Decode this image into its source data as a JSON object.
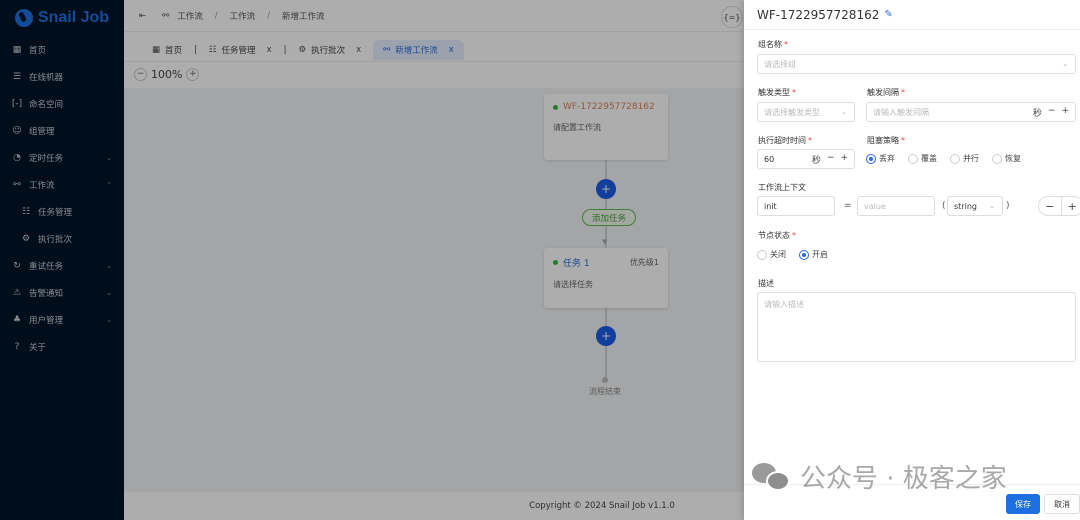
{
  "sidebar": {
    "logo": "Snail Job",
    "items": [
      {
        "icon": "dashboard-icon",
        "glyph": "▦",
        "label": "首页"
      },
      {
        "icon": "server-icon",
        "glyph": "☰",
        "label": "在线机器"
      },
      {
        "icon": "namespace-icon",
        "glyph": "[-]",
        "label": "命名空间"
      },
      {
        "icon": "group-icon",
        "glyph": "☺",
        "label": "组管理"
      },
      {
        "icon": "timer-task-icon",
        "glyph": "◔",
        "label": "定时任务",
        "arrow": "⌄"
      },
      {
        "icon": "workflow-icon",
        "glyph": "⚯",
        "label": "工作流",
        "arrow": "⌃"
      },
      {
        "icon": "task-list-icon",
        "glyph": "☷",
        "label": "任务管理"
      },
      {
        "icon": "batch-icon",
        "glyph": "⚙",
        "label": "执行批次"
      },
      {
        "icon": "retry-icon",
        "glyph": "↻",
        "label": "重试任务",
        "arrow": "⌄"
      },
      {
        "icon": "alarm-icon",
        "glyph": "⚠",
        "label": "告警通知",
        "arrow": "⌄"
      },
      {
        "icon": "user-icon",
        "glyph": "♣",
        "label": "用户管理",
        "arrow": "⌄"
      },
      {
        "icon": "help-icon",
        "glyph": "?",
        "label": "关于"
      }
    ]
  },
  "header": {
    "menu_toggle": "⇤",
    "breadcrumb": [
      "工作流",
      "工作流",
      "新增工作流"
    ],
    "breadcrumb_sep": "/",
    "bracket_icon": "{=}"
  },
  "tabs": [
    {
      "label": "首页",
      "glyph": "▦"
    },
    {
      "label": "任务管理",
      "glyph": "☷",
      "close": "x"
    },
    {
      "label": "执行批次",
      "glyph": "⚙",
      "close": "x"
    },
    {
      "label": "新增工作流",
      "glyph": "⚯",
      "close": "x",
      "active": true
    }
  ],
  "zoom": {
    "minus": "−",
    "value": "100%",
    "plus": "+"
  },
  "flow": {
    "start_node": {
      "title": "WF-1722957728162",
      "desc": "请配置工作流"
    },
    "add_label": "+",
    "add_task_pill": "添加任务",
    "task_node": {
      "title": "任务 1",
      "priority": "优先级1",
      "desc": "请选择任务"
    },
    "end_label": "流程结束"
  },
  "footer": "Copyright © 2024 Snail Job v1.1.0",
  "drawer": {
    "title": "WF-1722957728162",
    "edit_icon": "✎",
    "required_mark": "*",
    "group_name": {
      "label": "组名称",
      "placeholder": "请选择组"
    },
    "trigger_type": {
      "label": "触发类型",
      "placeholder": "请选择触发类型"
    },
    "trigger_interval": {
      "label": "触发间隔",
      "placeholder": "请输入触发间隔",
      "unit": "秒"
    },
    "timeout": {
      "label": "执行超时时间",
      "value": "60",
      "unit": "秒"
    },
    "block_strategy": {
      "label": "阻塞策略",
      "options": [
        "丢弃",
        "覆盖",
        "并行",
        "恢复"
      ],
      "selected": "丢弃"
    },
    "context": {
      "label": "工作流上下文",
      "key": "init",
      "eq": "=",
      "value_placeholder": "value",
      "type": "string",
      "open_paren": "(",
      "close_paren": ")"
    },
    "node_status": {
      "label": "节点状态",
      "options": [
        "关闭",
        "开启"
      ],
      "selected": "开启"
    },
    "description": {
      "label": "描述",
      "placeholder": "请输入描述"
    },
    "save": "保存",
    "cancel": "取消",
    "minus": "−",
    "plus": "+",
    "chevron": "⌄"
  },
  "watermark": "公众号 · 极客之家",
  "colors": {
    "primary": "#1d6fe0",
    "sidebar_bg": "#001428",
    "success": "#3bb63b",
    "required": "#e54545"
  }
}
